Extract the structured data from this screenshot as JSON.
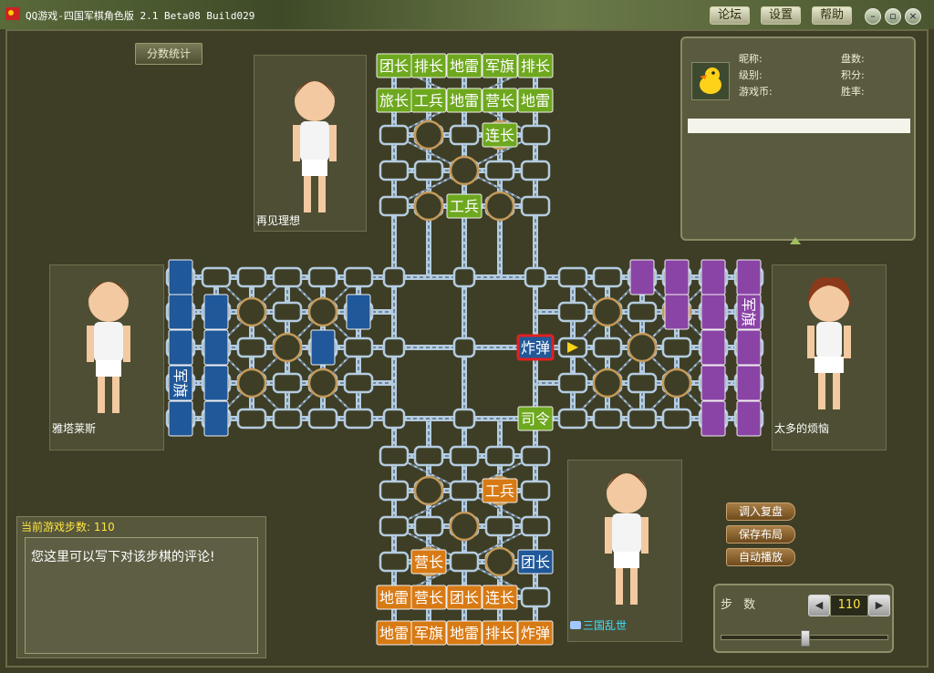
{
  "window": {
    "title": "QQ游戏-四国军棋角色版 2.1 Beta08 Build029",
    "buttons": [
      "论坛",
      "设置",
      "帮助"
    ],
    "controls": [
      "minimize",
      "restore",
      "close"
    ]
  },
  "stats_button": "分数统计",
  "players": {
    "top": "再见理想",
    "left": "雅塔莱斯",
    "right": "太多的烦恼",
    "bottom": "三国乱世"
  },
  "info_panel": {
    "nickname_label": "昵称:",
    "level_label": "级别:",
    "coins_label": "游戏币:",
    "games_label": "盘数:",
    "points_label": "积分:",
    "winrate_label": "胜率:",
    "icon": "duck-avatar-icon"
  },
  "comment": {
    "header_label": "当前游戏步数:",
    "header_value": "110",
    "text": "您这里可以写下对该步棋的评论!"
  },
  "side_buttons": [
    "调入复盘",
    "保存布局",
    "自动播放"
  ],
  "stepper": {
    "label": "步 数",
    "value": "110",
    "position_fraction": 0.5
  },
  "colors": {
    "green_piece": "#6ea81e",
    "orange_piece": "#d87a14",
    "blue_piece": "#20589a",
    "purple_piece": "#8a44a6",
    "rail": "#b4cce0",
    "highlight": "#e02020"
  },
  "pieces": {
    "top_row1": [
      "团长",
      "排长",
      "地雷",
      "军旗",
      "排长"
    ],
    "top_row2": [
      "旅长",
      "工兵",
      "地雷",
      "营长",
      "地雷"
    ],
    "top_extra": [
      "连长",
      "工兵"
    ],
    "bottom_row6": [
      "地雷",
      "军旗",
      "地雷",
      "排长",
      "炸弹"
    ],
    "bottom_row5": [
      "地雷",
      "营长",
      "团长",
      "连长"
    ],
    "bottom_extra": [
      "工兵",
      "营长",
      "团长"
    ],
    "center": [
      "炸弹",
      "司令"
    ],
    "left_flag": "军旗",
    "right_flag": "军旗"
  }
}
